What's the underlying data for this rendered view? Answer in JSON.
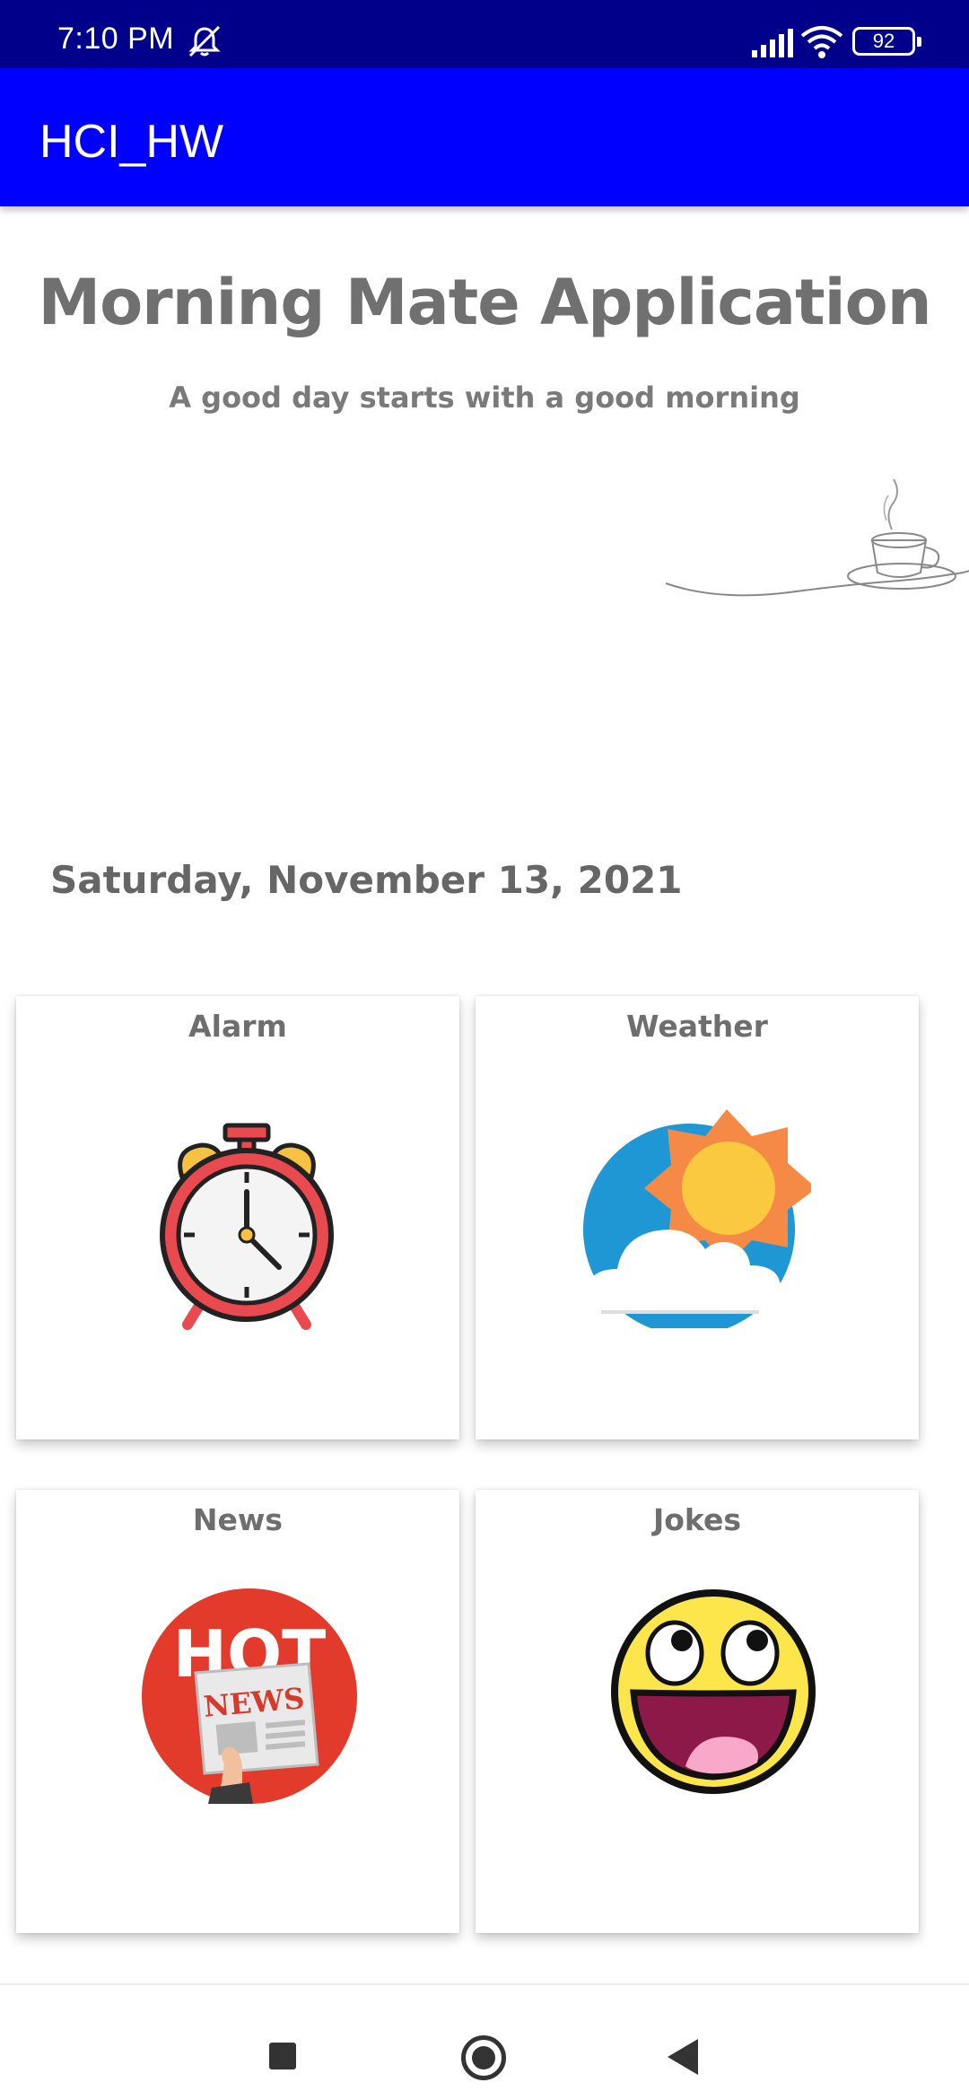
{
  "status_bar": {
    "time": "7:10 PM",
    "battery": "92",
    "icons": [
      "dnd-bell-icon",
      "signal-icon",
      "wifi-icon",
      "battery-icon"
    ]
  },
  "app_bar": {
    "title": "HCI_HW",
    "color": "#0000ff"
  },
  "header": {
    "title": "Morning Mate Application",
    "subtitle": "A good day starts with a good morning"
  },
  "date": "Saturday, November 13, 2021",
  "cards": [
    {
      "label": "Alarm",
      "icon": "alarm-clock-icon"
    },
    {
      "label": "Weather",
      "icon": "sun-cloud-icon"
    },
    {
      "label": "News",
      "icon": "hot-news-icon"
    },
    {
      "label": "Jokes",
      "icon": "laughing-face-icon"
    }
  ],
  "news_icon_text": {
    "top": "HOT",
    "paper": "NEWS"
  },
  "nav_bar": {
    "buttons": [
      "recents-button",
      "home-button",
      "back-button"
    ]
  },
  "colors": {
    "status_bar": "#00008b",
    "app_bar": "#0000ff",
    "text_gray": "#707070"
  }
}
